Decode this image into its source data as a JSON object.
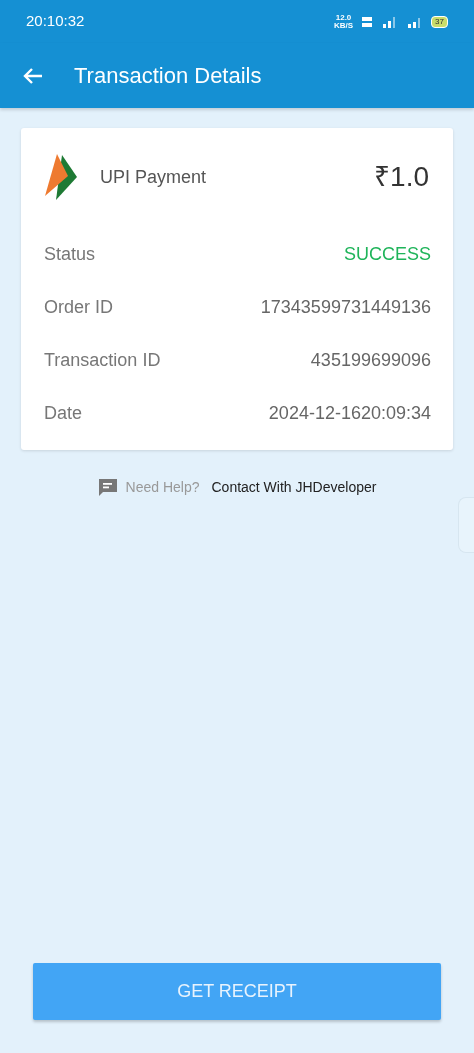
{
  "status_bar": {
    "time": "20:10:32",
    "network_speed": "12.0",
    "speed_unit": "KB/S",
    "battery": "37"
  },
  "app_bar": {
    "title": "Transaction Details"
  },
  "payment": {
    "method": "UPI Payment",
    "amount": "₹1.0"
  },
  "details": [
    {
      "label": "Status",
      "value": "SUCCESS",
      "kind": "status"
    },
    {
      "label": "Order ID",
      "value": "17343599731449136",
      "kind": "plain"
    },
    {
      "label": "Transaction ID",
      "value": "435199699096",
      "kind": "plain"
    },
    {
      "label": "Date",
      "value": "2024-12-1620:09:34",
      "kind": "plain"
    }
  ],
  "help": {
    "prompt": "Need Help?",
    "link": "Contact With JHDeveloper"
  },
  "receipt_button": {
    "label": "GET RECEIPT"
  }
}
